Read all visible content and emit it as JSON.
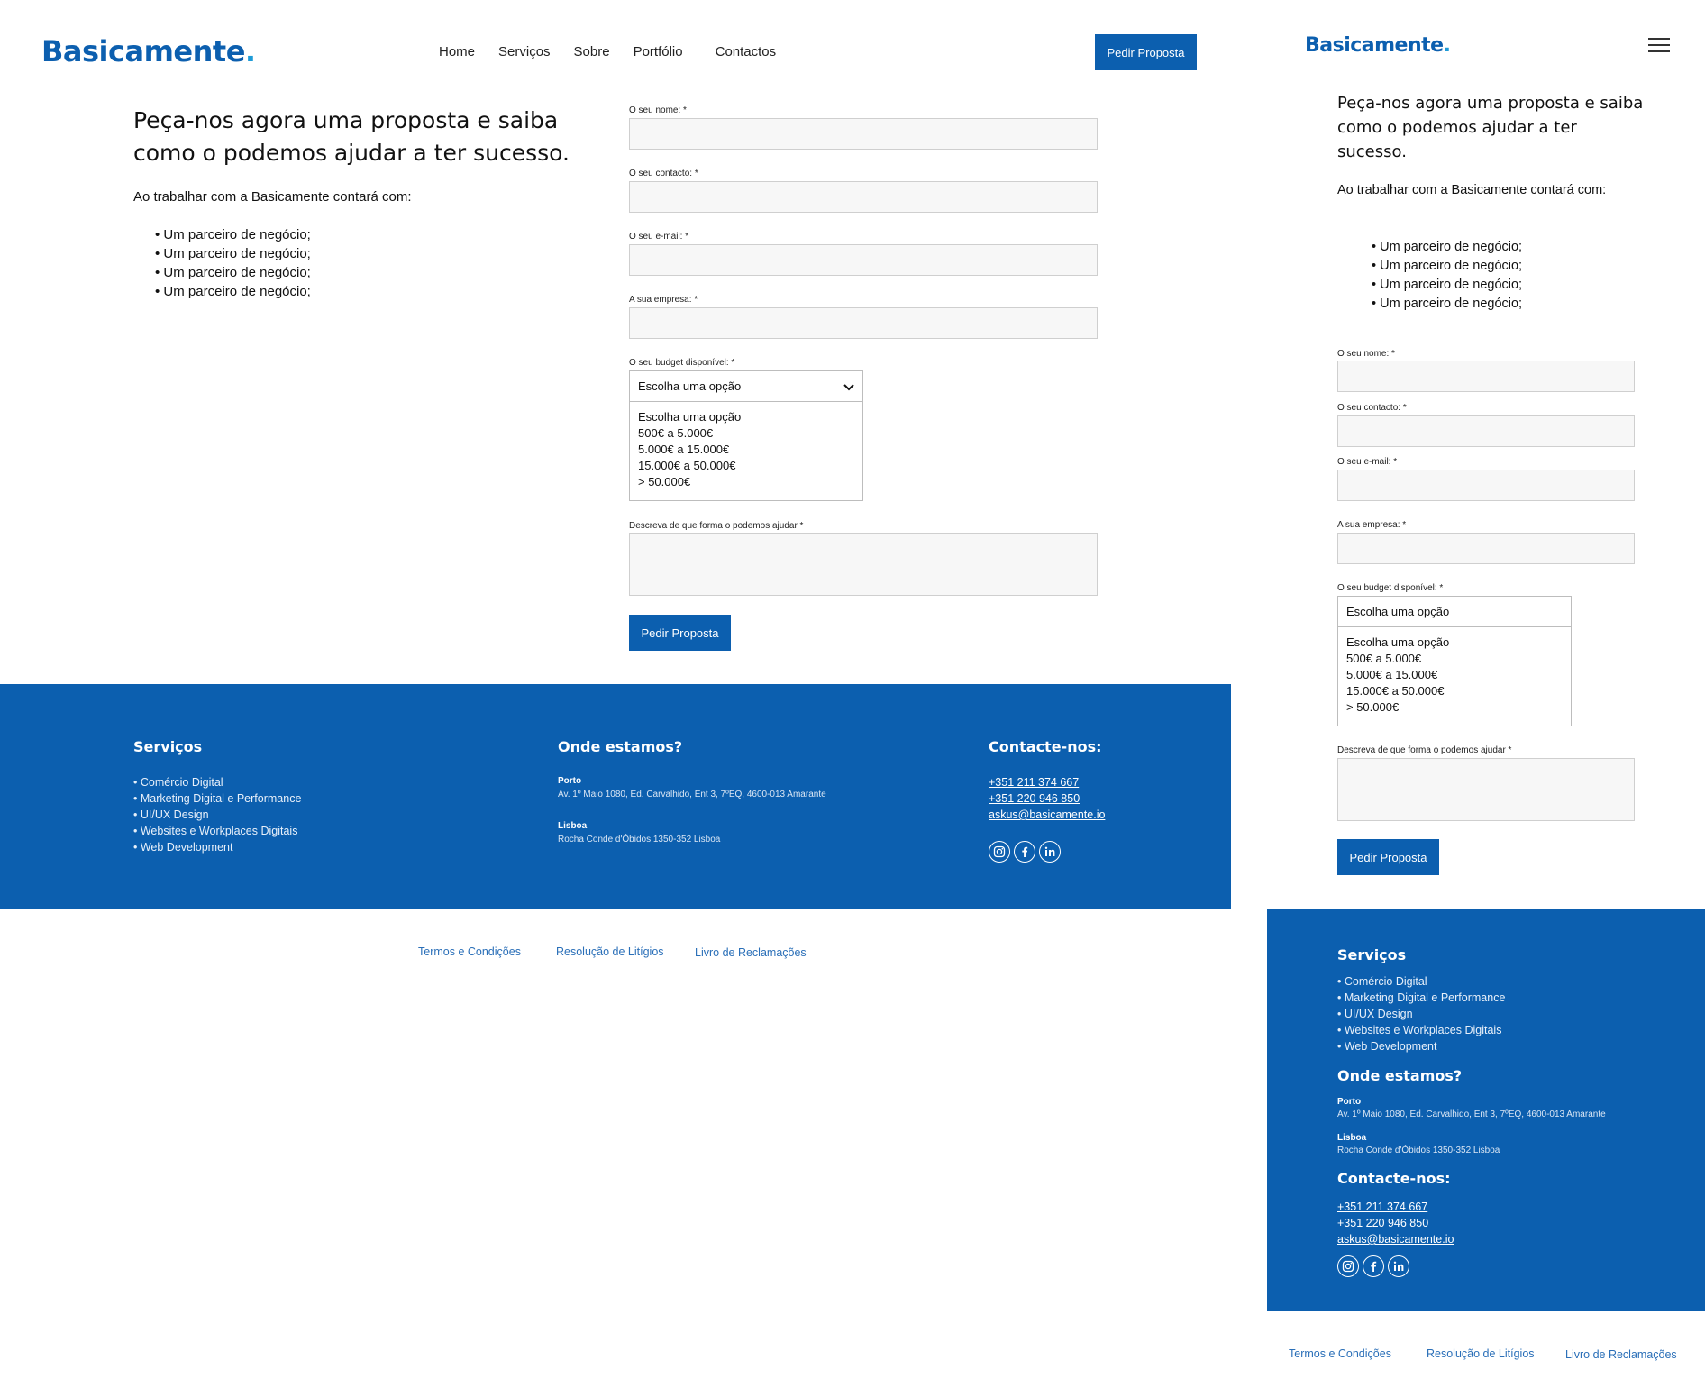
{
  "brand": {
    "name": "Basicamente",
    "dot": "."
  },
  "nav": {
    "items": [
      "Home",
      "Serviços",
      "Sobre",
      "Portfólio",
      "Contactos"
    ],
    "cta": "Pedir Proposta"
  },
  "hero": {
    "title": "Peça-nos agora uma proposta e saiba como o podemos ajudar a ter sucesso.",
    "intro": "Ao trabalhar com a Basicamente contará com:",
    "benefits": [
      "Um parceiro de negócio;",
      "Um parceiro de negócio;",
      "Um parceiro de negócio;",
      "Um parceiro de negócio;"
    ]
  },
  "form": {
    "name_label": "O seu nome: *",
    "contact_label": "O seu contacto: *",
    "email_label": "O seu e-mail: *",
    "company_label": "A sua empresa: *",
    "budget_label": "O seu budget disponível: *",
    "budget_selected": "Escolha uma opção",
    "budget_options": [
      "Escolha uma opção",
      "500€ a 5.000€",
      "5.000€ a 15.000€",
      "15.000€ a 50.000€",
      "> 50.000€"
    ],
    "description_label": "Descreva de que forma o podemos ajudar *",
    "submit": "Pedir Proposta"
  },
  "footer": {
    "services_title": "Serviços",
    "services": [
      "Comércio Digital",
      "Marketing Digital e Performance",
      "UI/UX Design",
      "Websites e Workplaces Digitais",
      "Web Development"
    ],
    "location_title": "Onde estamos?",
    "porto_city": "Porto",
    "porto_address": "Av. 1º Maio 1080, Ed. Carvalhido, Ent 3, 7ºEQ, 4600-013 Amarante",
    "lisboa_city": "Lisboa",
    "lisboa_address": "Rocha Conde d'Óbidos 1350-352 Lisboa",
    "contact_title": "Contacte-nos:",
    "phone1": "+351 211 374 667",
    "phone2": "+351 220 946 850",
    "email": "askus@basicamente.io",
    "social": [
      "instagram-icon",
      "facebook-icon",
      "linkedin-icon"
    ]
  },
  "legal": {
    "terms": "Termos e Condições",
    "disputes": "Resolução de Litígios",
    "complaints": "Livro de Reclamações"
  },
  "colors": {
    "brand_blue": "#0C5FAF",
    "brand_dot": "#1E9BD7",
    "input_bg": "#F7F7F7"
  }
}
